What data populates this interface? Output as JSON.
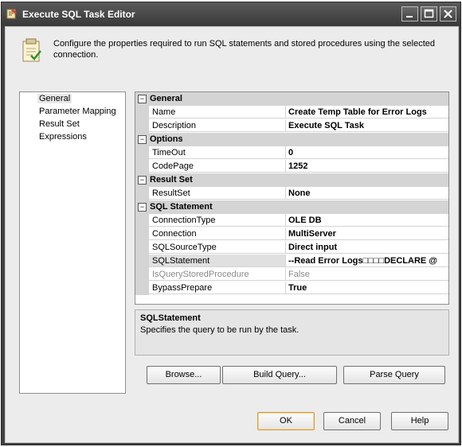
{
  "window": {
    "title": "Execute SQL Task Editor"
  },
  "header": {
    "description": "Configure the properties required to run SQL statements and stored procedures using the selected connection."
  },
  "nav": {
    "items": [
      "General",
      "Parameter Mapping",
      "Result Set",
      "Expressions"
    ],
    "selected": "General"
  },
  "grid": {
    "categories": [
      {
        "label": "General",
        "expander": "⊟",
        "props": [
          {
            "name": "Name",
            "value": "Create Temp Table for Error Logs"
          },
          {
            "name": "Description",
            "value": "Execute SQL Task"
          }
        ]
      },
      {
        "label": "Options",
        "expander": "⊟",
        "props": [
          {
            "name": "TimeOut",
            "value": "0"
          },
          {
            "name": "CodePage",
            "value": "1252"
          }
        ]
      },
      {
        "label": "Result Set",
        "expander": "⊟",
        "props": [
          {
            "name": "ResultSet",
            "value": "None"
          }
        ]
      },
      {
        "label": "SQL Statement",
        "expander": "⊟",
        "props": [
          {
            "name": "ConnectionType",
            "value": "OLE DB"
          },
          {
            "name": "Connection",
            "value": "MultiServer"
          },
          {
            "name": "SQLSourceType",
            "value": "Direct input"
          },
          {
            "name": "SQLStatement",
            "value": "--Read Error Logs□□□□DECLARE @"
          },
          {
            "name": "IsQueryStoredProcedure",
            "value": "False"
          },
          {
            "name": "BypassPrepare",
            "value": "True"
          }
        ]
      }
    ]
  },
  "description_panel": {
    "title": "SQLStatement",
    "text": "Specifies the query to be run by the task."
  },
  "buttons": {
    "browse": "Browse...",
    "build_query": "Build Query...",
    "parse_query": "Parse Query",
    "ok": "OK",
    "cancel": "Cancel",
    "help": "Help"
  },
  "icons": {
    "title": "sql-task-icon",
    "header": "clipboard-check-icon"
  }
}
